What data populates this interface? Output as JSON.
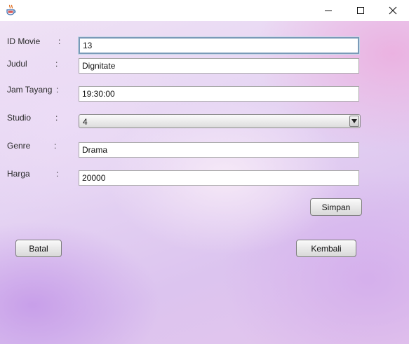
{
  "window": {
    "icon": "java-cup-icon",
    "controls": [
      "minimize",
      "maximize",
      "close"
    ]
  },
  "form": {
    "id_movie": {
      "label": "ID Movie",
      "colon": ":",
      "value": "13"
    },
    "judul": {
      "label": "Judul",
      "colon": ":",
      "value": "Dignitate"
    },
    "jam_tayang": {
      "label": "Jam Tayang",
      "colon": ":",
      "value": "19:30:00"
    },
    "studio": {
      "label": "Studio",
      "colon": ":",
      "value": "4"
    },
    "genre": {
      "label": "Genre",
      "colon": ":",
      "value": "Drama"
    },
    "harga": {
      "label": "Harga",
      "colon": ":",
      "value": "20000"
    }
  },
  "buttons": {
    "simpan": "Simpan",
    "batal": "Batal",
    "kembali": "Kembali"
  }
}
